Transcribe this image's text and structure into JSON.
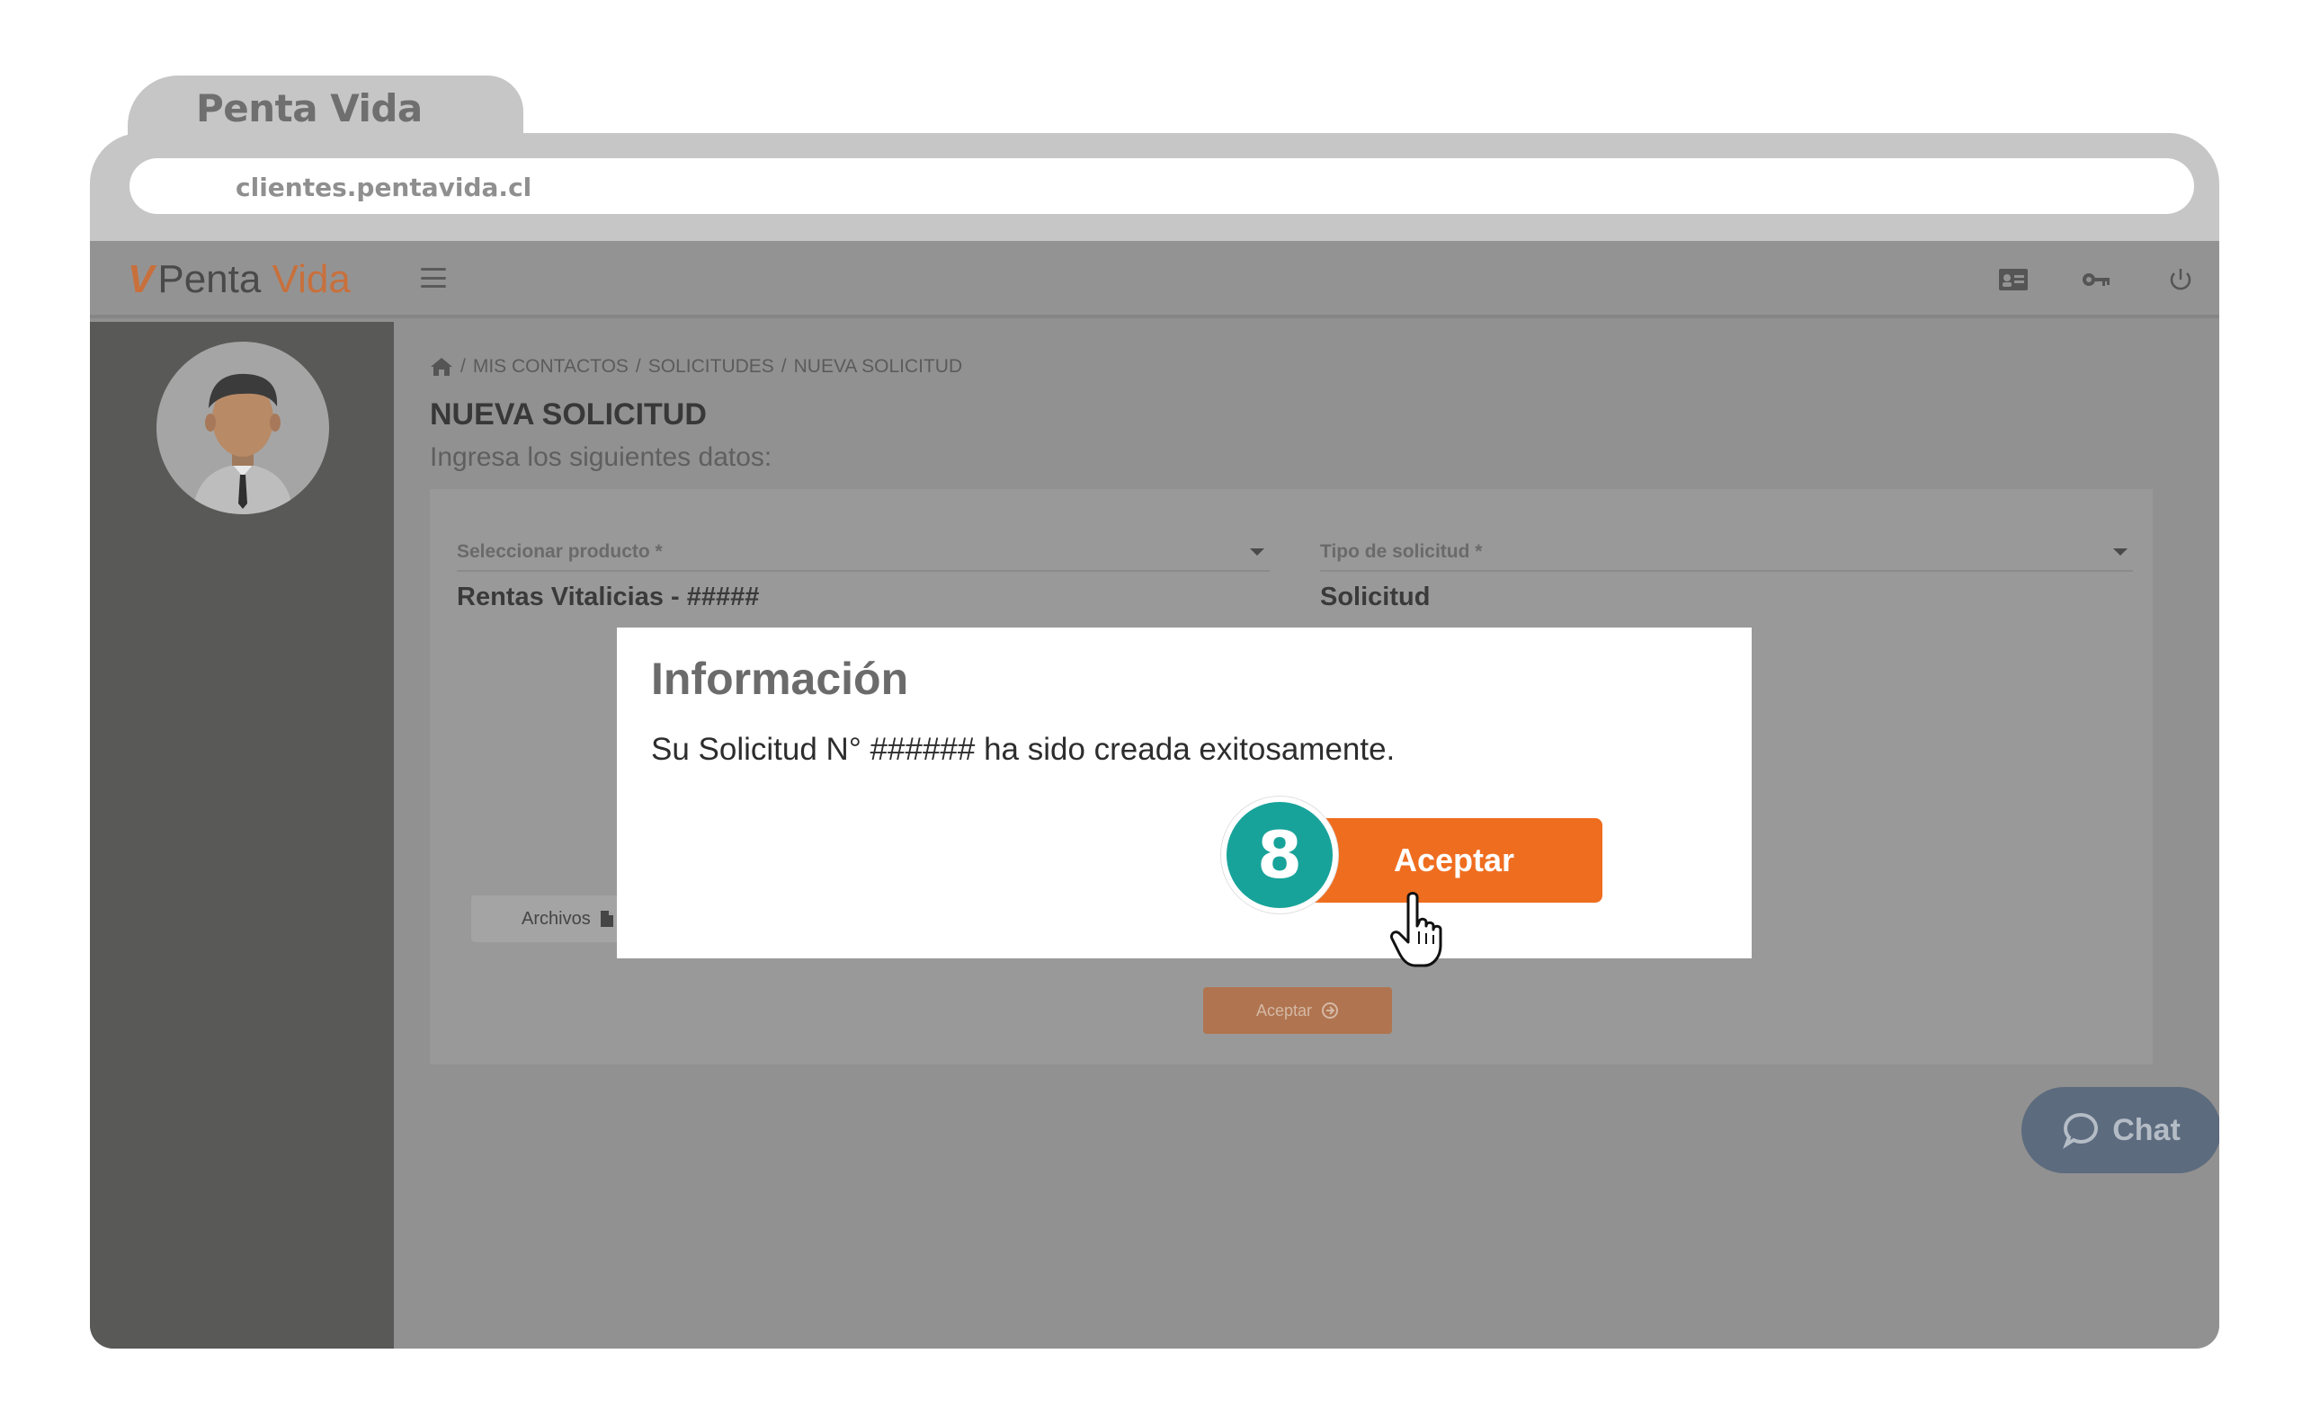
{
  "browser": {
    "tab_title": "Penta Vida",
    "url": "clientes.pentavida.cl"
  },
  "header": {
    "logo_mark": "V",
    "logo_word1": "Penta",
    "logo_word2": "Vida",
    "icons": [
      "menu-icon",
      "id-card-icon",
      "key-icon",
      "power-icon"
    ]
  },
  "breadcrumb": {
    "items": [
      "MIS CONTACTOS",
      "SOLICITUDES",
      "NUEVA SOLICITUD"
    ],
    "separator": "/"
  },
  "page": {
    "title": "NUEVA SOLICITUD",
    "subtitle": "Ingresa los siguientes datos:"
  },
  "form": {
    "product_label": "Seleccionar producto *",
    "product_value": "Rentas Vitalicias - #####",
    "type_label": "Tipo de solicitud *",
    "type_value": "Solicitud",
    "files_label": "Archivos",
    "accept_label": "Aceptar"
  },
  "chat": {
    "label": "Chat"
  },
  "modal": {
    "title": "Información",
    "message": "Su Solicitud N° ###### ha sido creada exitosamente.",
    "accept_label": "Aceptar",
    "step_number": "8"
  },
  "colors": {
    "accent_orange": "#ef6d1f",
    "step_teal": "#18a39a",
    "sidebar": "#595958",
    "overlay_bg": "#929191"
  }
}
